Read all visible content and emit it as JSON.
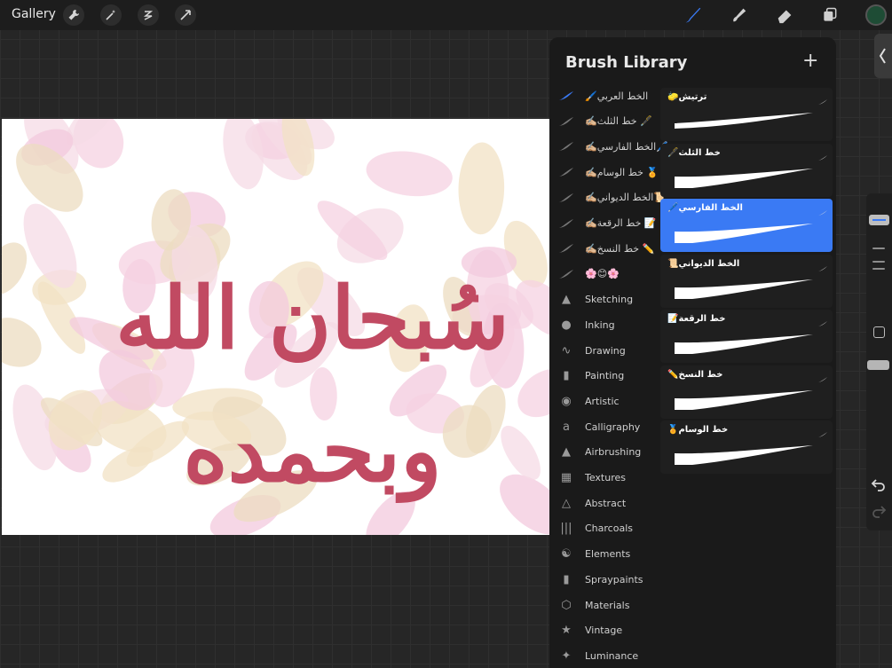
{
  "topbar": {
    "gallery_label": "Gallery",
    "left_tools": [
      "wrench-icon",
      "magic-wand-icon",
      "selection-icon",
      "transform-icon"
    ],
    "right_tools": [
      "brush-icon",
      "smudge-icon",
      "eraser-icon",
      "layers-icon"
    ],
    "active_tool": "brush",
    "accent_color": "#3a7af4",
    "current_color": "#1e4c35"
  },
  "canvas": {
    "calligraphy_text": "سُبحان الله وبحمده",
    "text_color": "#c14a62",
    "dot_color": "#1e4c35"
  },
  "brush_library": {
    "title": "Brush Library",
    "add_label": "+",
    "categories": [
      {
        "label": "🖌️الخط العربي",
        "icon": "wave"
      },
      {
        "label": "✍🏼خط الثلث 🖋️",
        "icon": "wave"
      },
      {
        "label": "✍🏼الخط الفارسي🖊️",
        "icon": "wave"
      },
      {
        "label": "✍🏼خط الوسام 🏅",
        "icon": "wave"
      },
      {
        "label": "✍🏼الخط الديواني📜",
        "icon": "wave"
      },
      {
        "label": "✍🏼خط الرقعة 📝",
        "icon": "wave"
      },
      {
        "label": "✍🏼خط النسخ ✏️",
        "icon": "wave"
      },
      {
        "label": "🌸😊🌸",
        "icon": "wave"
      },
      {
        "label": "Sketching",
        "icon": "▲"
      },
      {
        "label": "Inking",
        "icon": "●"
      },
      {
        "label": "Drawing",
        "icon": "∿"
      },
      {
        "label": "Painting",
        "icon": "▮"
      },
      {
        "label": "Artistic",
        "icon": "◉"
      },
      {
        "label": "Calligraphy",
        "icon": "a"
      },
      {
        "label": "Airbrushing",
        "icon": "▲"
      },
      {
        "label": "Textures",
        "icon": "▦"
      },
      {
        "label": "Abstract",
        "icon": "△"
      },
      {
        "label": "Charcoals",
        "icon": "|||"
      },
      {
        "label": "Elements",
        "icon": "☯"
      },
      {
        "label": "Spraypaints",
        "icon": "▮"
      },
      {
        "label": "Materials",
        "icon": "⬡"
      },
      {
        "label": "Vintage",
        "icon": "★"
      },
      {
        "label": "Luminance",
        "icon": "✦"
      }
    ],
    "selected_category_index": 0,
    "brushes": [
      {
        "name": "🧽ترتيش",
        "selected": false
      },
      {
        "name": "🖋️خط الثلث",
        "selected": false
      },
      {
        "name": "🖊️الخط الفارسي",
        "selected": true
      },
      {
        "name": "📜الخط الديواني",
        "selected": false
      },
      {
        "name": "📝خط الرقعة",
        "selected": false
      },
      {
        "name": "✏️خط النسخ",
        "selected": false
      },
      {
        "name": "🏅خط الوسام",
        "selected": false
      }
    ]
  }
}
